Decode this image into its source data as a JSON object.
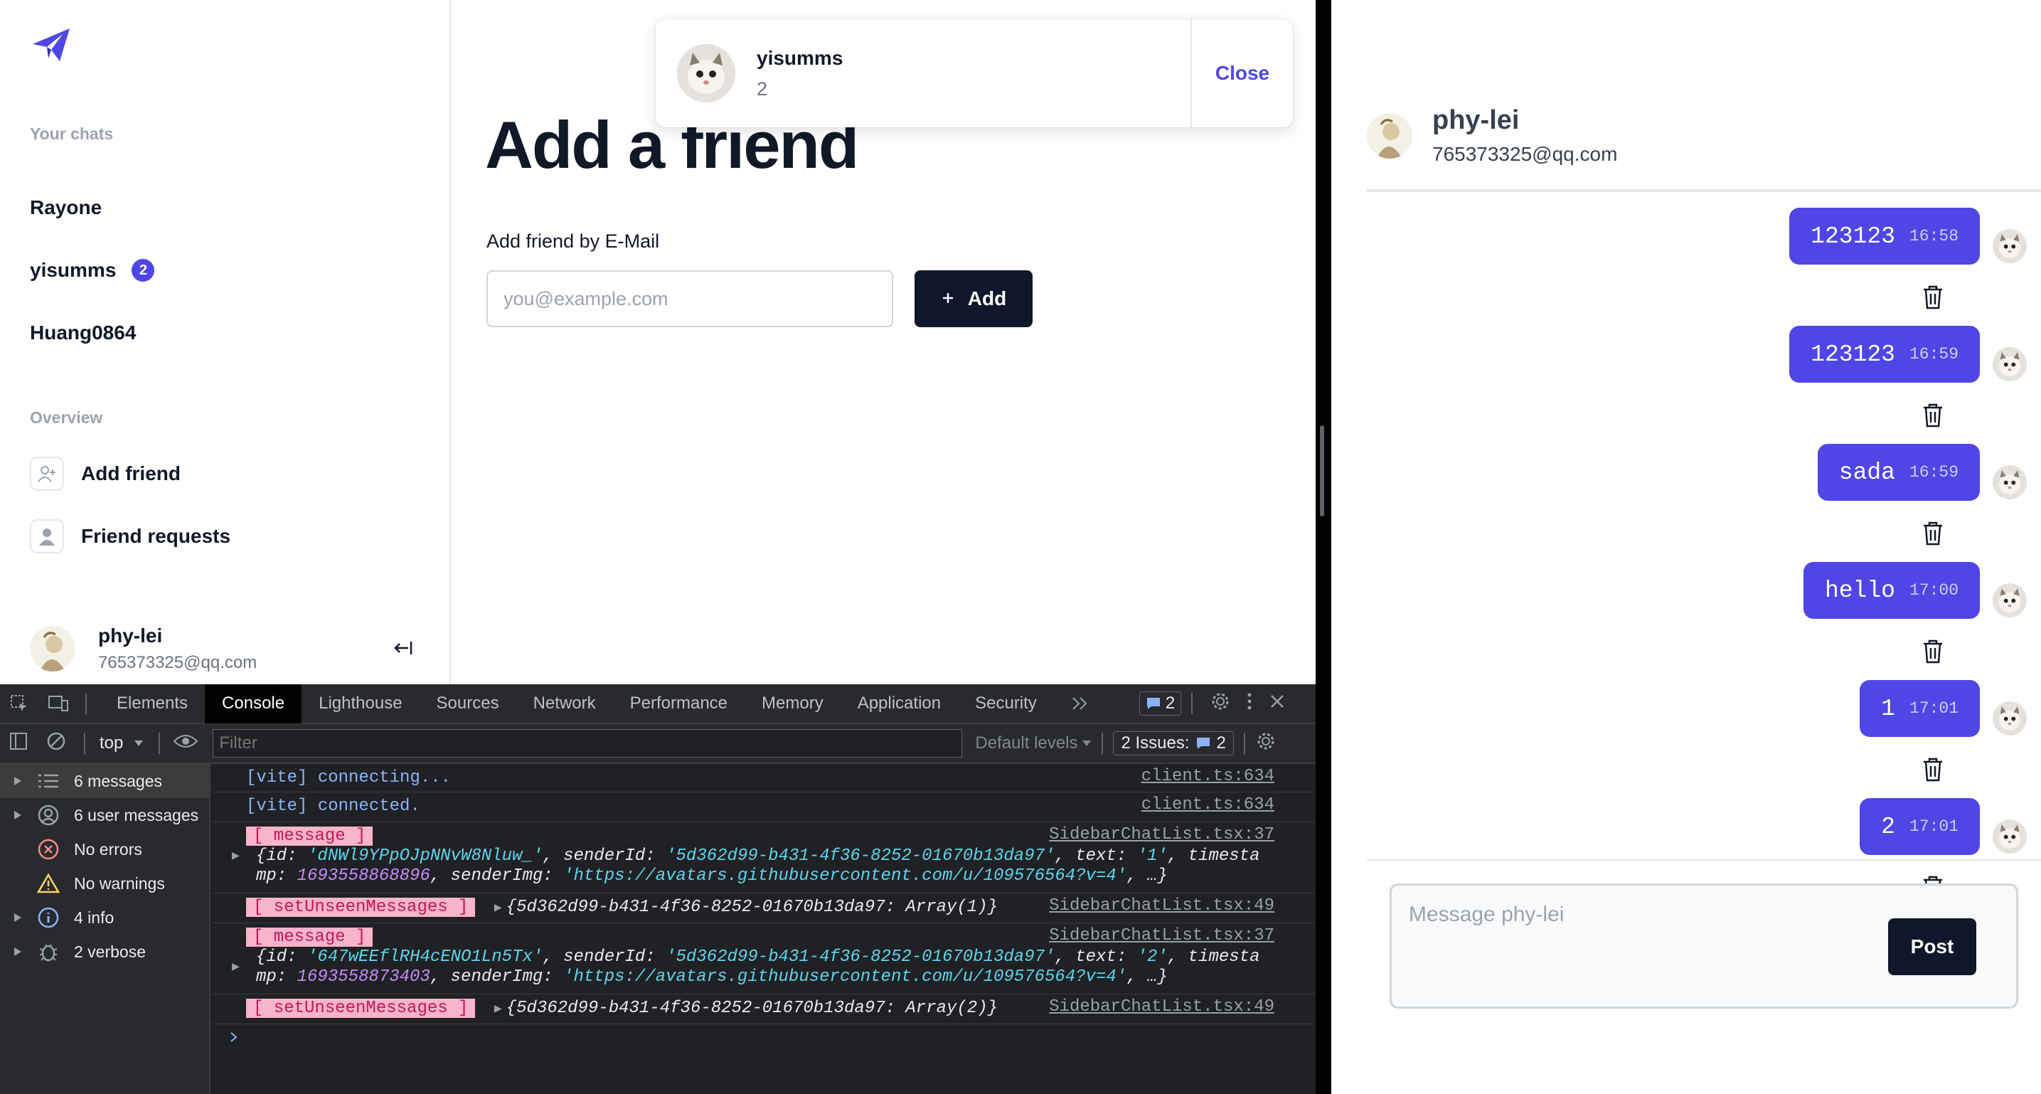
{
  "sidebar": {
    "your_chats_label": "Your chats",
    "chats": [
      {
        "name": "Rayone",
        "unseen": ""
      },
      {
        "name": "yisumms",
        "unseen": "2"
      },
      {
        "name": "Huang0864",
        "unseen": ""
      }
    ],
    "overview_label": "Overview",
    "overview_items": [
      {
        "label": "Add friend",
        "icon": "user-plus-icon"
      },
      {
        "label": "Friend requests",
        "icon": "user-icon"
      }
    ],
    "profile": {
      "name": "phy-lei",
      "email": "765373325@qq.com"
    },
    "signout_icon": "sign-out-icon"
  },
  "main": {
    "title": "Add a friend",
    "form_label": "Add friend by E-Mail",
    "email_placeholder": "you@example.com",
    "add_button": "Add"
  },
  "toast": {
    "sender": "yisumms",
    "message": "2",
    "close_label": "Close"
  },
  "devtools": {
    "tabs": [
      "Elements",
      "Console",
      "Lighthouse",
      "Sources",
      "Network",
      "Performance",
      "Memory",
      "Application",
      "Security"
    ],
    "active_tab": "Console",
    "issues_badge": "2",
    "context": "top",
    "filter_placeholder": "Filter",
    "default_levels": "Default levels",
    "issues_label": "2 Issues:",
    "issues_count": "2",
    "sidebar": [
      {
        "label": "6 messages",
        "icon": "list-icon"
      },
      {
        "label": "6 user messages",
        "icon": "user-circle-icon"
      },
      {
        "label": "No errors",
        "icon": "error-icon"
      },
      {
        "label": "No warnings",
        "icon": "warning-icon"
      },
      {
        "label": "4 info",
        "icon": "info-icon"
      },
      {
        "label": "2 verbose",
        "icon": "bug-icon"
      }
    ],
    "logs": {
      "l1_text": "[vite] connecting...",
      "l1_src": "client.ts:634",
      "l2_text": "[vite] connected.",
      "l2_src": "client.ts:634",
      "l3_tag": "[ message ]",
      "l3_src": "SidebarChatList.tsx:37",
      "l3_id": "'dNWl9YPpOJpNNvW8Nluw_'",
      "l3_sender": "'5d362d99-b431-4f36-8252-01670b13da97'",
      "l3_text": "'1'",
      "l3_ts": "1693558868896",
      "l3_img": "'https://avatars.githubusercontent.com/u/109576564?v=4'",
      "l4_tag": "[ setUnseenMessages ]",
      "l4_obj": "{5d362d99-b431-4f36-8252-01670b13da97: Array(1)}",
      "l4_src": "SidebarChatList.tsx:49",
      "l5_tag": "[ message ]",
      "l5_src": "SidebarChatList.tsx:37",
      "l5_id": "'647wEEflRH4cENO1Ln5Tx'",
      "l5_sender": "'5d362d99-b431-4f36-8252-01670b13da97'",
      "l5_text": "'2'",
      "l5_ts": "1693558873403",
      "l5_img": "'https://avatars.githubusercontent.com/u/109576564?v=4'",
      "l6_tag": "[ setUnseenMessages ]",
      "l6_obj": "{5d362d99-b431-4f36-8252-01670b13da97: Array(2)}",
      "l6_src": "SidebarChatList.tsx:49",
      "k_id": "{id: ",
      "k_sender": ", senderId: ",
      "k_text": ", text: ",
      "k_ts1": ", timesta",
      "k_ts2": "mp: ",
      "k_img": ", senderImg: ",
      "k_end": ", …}"
    }
  },
  "chat": {
    "partner_name": "phy-lei",
    "partner_email": "765373325@qq.com",
    "messages": [
      {
        "text": "123123",
        "time": "16:58"
      },
      {
        "text": "123123",
        "time": "16:59"
      },
      {
        "text": "sada",
        "time": "16:59"
      },
      {
        "text": "hello",
        "time": "17:00"
      },
      {
        "text": "1",
        "time": "17:01"
      },
      {
        "text": "2",
        "time": "17:01"
      }
    ],
    "placeholder": "Message phy-lei",
    "post_label": "Post"
  },
  "colors": {
    "accent": "#4f46e5",
    "dark_button": "#0f172a"
  }
}
